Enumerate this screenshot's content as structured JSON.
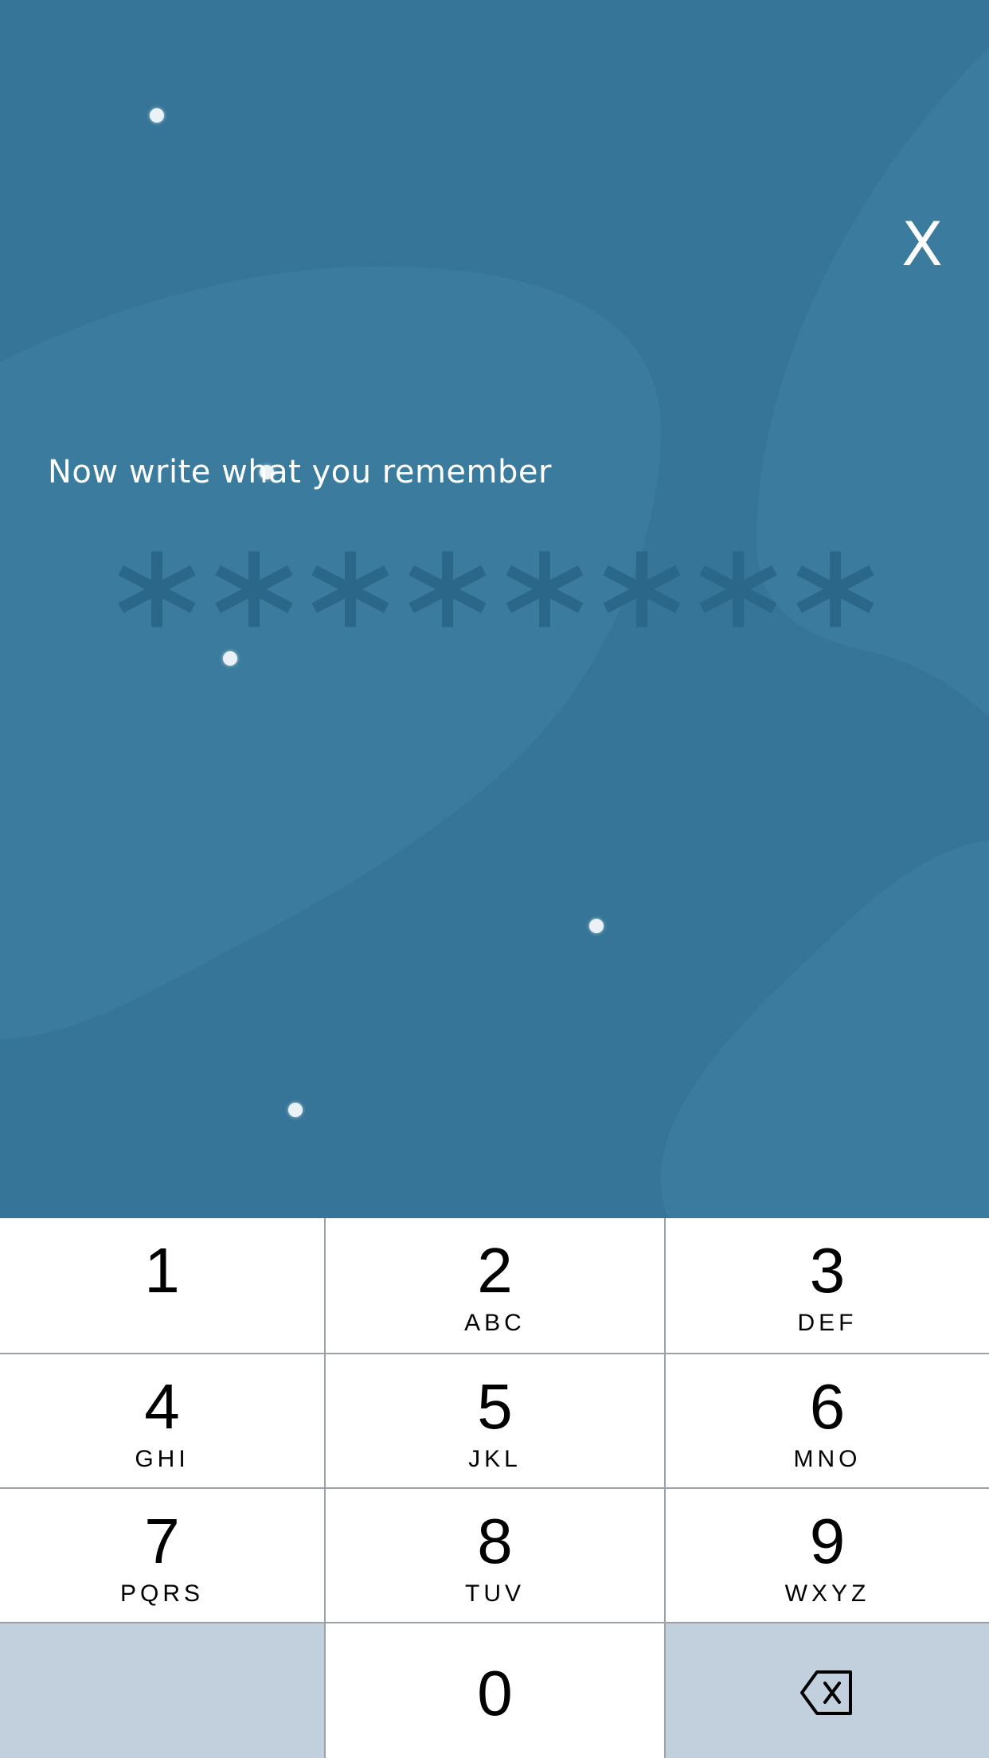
{
  "header": {
    "close_label": "X"
  },
  "prompt": {
    "text": "Now write what you remember"
  },
  "input": {
    "masked_digits": 8
  },
  "colors": {
    "background": "#367597",
    "mask_asterisk": "#2a6789",
    "keypad_gray": "#c1d0dc"
  },
  "keypad": {
    "keys": [
      {
        "digit": "1",
        "letters": ""
      },
      {
        "digit": "2",
        "letters": "ABC"
      },
      {
        "digit": "3",
        "letters": "DEF"
      },
      {
        "digit": "4",
        "letters": "GHI"
      },
      {
        "digit": "5",
        "letters": "JKL"
      },
      {
        "digit": "6",
        "letters": "MNO"
      },
      {
        "digit": "7",
        "letters": "PQRS"
      },
      {
        "digit": "8",
        "letters": "TUV"
      },
      {
        "digit": "9",
        "letters": "WXYZ"
      },
      {
        "digit": "0",
        "letters": ""
      }
    ],
    "delete_icon": "backspace-icon"
  }
}
